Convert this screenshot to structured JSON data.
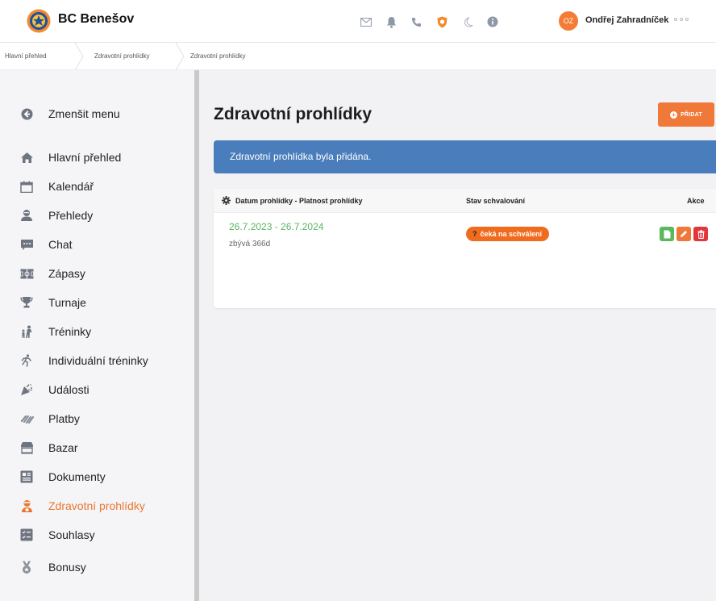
{
  "app": {
    "brand": "BC Benešov",
    "user_initials": "OZ",
    "user_name": "Ondřej Zahradníček"
  },
  "header_icons": [
    "mail-icon",
    "bell-icon",
    "phone-icon",
    "shield-icon",
    "moon-icon",
    "info-icon"
  ],
  "breadcrumb": {
    "items": [
      "Hlavní přehled",
      "Zdravotní prohlídky",
      "Zdravotní prohlídky"
    ]
  },
  "sidebar": {
    "collapse_label": "Zmenšit menu",
    "items": [
      {
        "label": "Hlavní přehled",
        "icon": "home-icon"
      },
      {
        "label": "Kalendář",
        "icon": "calendar-icon"
      },
      {
        "label": "Přehledy",
        "icon": "user-overview-icon"
      },
      {
        "label": "Chat",
        "icon": "chat-icon"
      },
      {
        "label": "Zápasy",
        "icon": "match-icon"
      },
      {
        "label": "Turnaje",
        "icon": "trophy-icon"
      },
      {
        "label": "Tréninky",
        "icon": "training-icon"
      },
      {
        "label": "Individuální tréninky",
        "icon": "running-icon"
      },
      {
        "label": "Události",
        "icon": "events-icon"
      },
      {
        "label": "Platby",
        "icon": "payments-icon"
      },
      {
        "label": "Bazar",
        "icon": "shop-icon"
      },
      {
        "label": "Dokumenty",
        "icon": "documents-icon"
      },
      {
        "label": "Zdravotní prohlídky",
        "icon": "doctor-icon",
        "active": true
      },
      {
        "label": "Souhlasy",
        "icon": "consents-icon"
      },
      {
        "label": "Bonusy",
        "icon": "medal-icon"
      }
    ]
  },
  "main": {
    "title": "Zdravotní prohlídky",
    "add_button": "PŘIDAT",
    "alert": "Zdravotní prohlídka byla přidána.",
    "table": {
      "columns": [
        "Datum prohlídky - Platnost prohlídky",
        "Stav schvalování",
        "Akce"
      ],
      "rows": [
        {
          "date_range": "26.7.2023 - 26.7.2024",
          "remaining": "zbývá 366d",
          "status": "čeká na schválení"
        }
      ]
    }
  },
  "colors": {
    "accent": "#f0793a",
    "alert_bg": "#4a7dbb",
    "date_green": "#5bb563",
    "status_orange": "#f16b1e",
    "action_view": "#5cb85c",
    "action_edit": "#f0793a",
    "action_delete": "#e2363b"
  }
}
